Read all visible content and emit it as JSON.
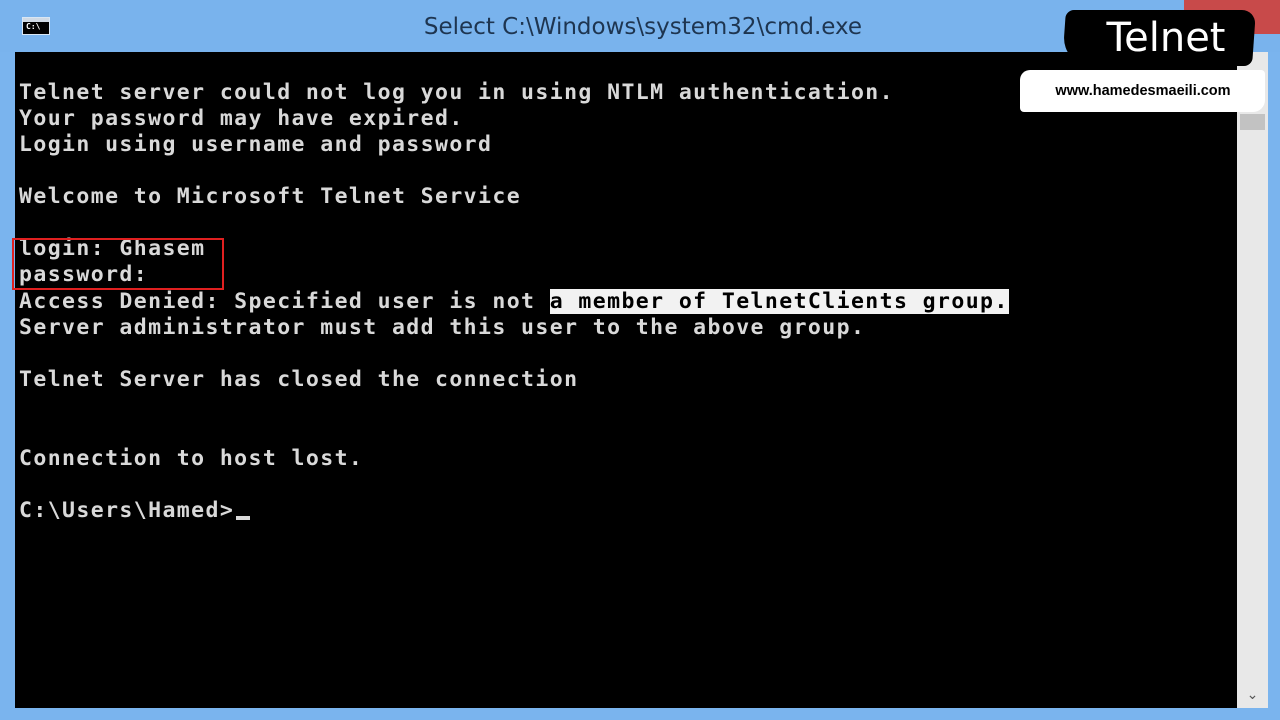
{
  "window": {
    "title": "Select C:\\Windows\\system32\\cmd.exe",
    "icon_text": "C:\\"
  },
  "console": {
    "lines": [
      "Telnet server could not log you in using NTLM authentication.",
      "Your password may have expired.",
      "Login using username and password",
      "",
      "Welcome to Microsoft Telnet Service",
      "",
      "login: Ghasem",
      "password:",
      "Access Denied: Specified user is not ",
      "Server administrator must add this user to the above group.",
      "",
      "Telnet Server has closed the connection",
      "",
      "",
      "Connection to host lost.",
      "",
      "C:\\Users\\Hamed>"
    ],
    "selected_text": "a member of TelnetClients group."
  },
  "scrollbar": {
    "down_arrow": "⌄"
  },
  "brand": {
    "title": "Telnet",
    "url": "www.hamedesmaeili.com"
  },
  "colors": {
    "frame": "#7ab4ee",
    "console_bg": "#000000",
    "console_text": "#d9d9d9",
    "highlight_box": "#e02020"
  }
}
